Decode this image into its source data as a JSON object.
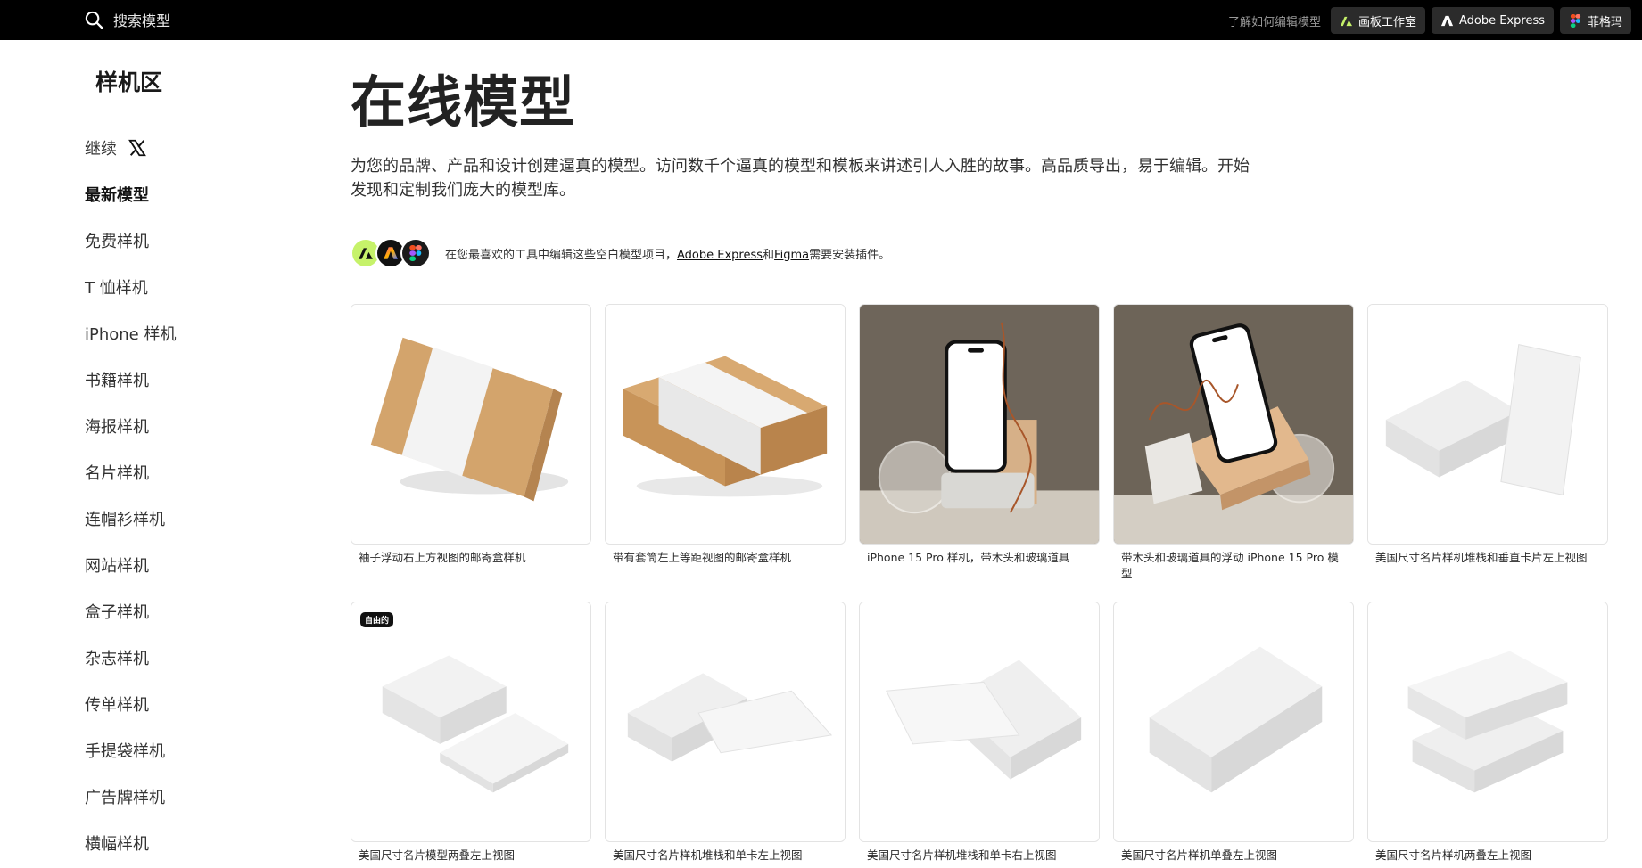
{
  "topbar": {
    "search_placeholder": "搜索模型",
    "learn_link": "了解如何编辑模型",
    "buttons": [
      {
        "label": "画板工作室",
        "icon": "artboard-studio-icon"
      },
      {
        "label": "Adobe Express",
        "icon": "adobe-express-icon"
      },
      {
        "label": "菲格玛",
        "icon": "figma-icon"
      }
    ]
  },
  "sidebar": {
    "title": "样机区",
    "items": [
      {
        "label": "继续"
      },
      {
        "label": "最新模型"
      },
      {
        "label": "免费样机"
      },
      {
        "label": "T 恤样机"
      },
      {
        "label": "iPhone 样机"
      },
      {
        "label": "书籍样机"
      },
      {
        "label": "海报样机"
      },
      {
        "label": "名片样机"
      },
      {
        "label": "连帽衫样机"
      },
      {
        "label": "网站样机"
      },
      {
        "label": "盒子样机"
      },
      {
        "label": "杂志样机"
      },
      {
        "label": "传单样机"
      },
      {
        "label": "手提袋样机"
      },
      {
        "label": "广告牌样机"
      },
      {
        "label": "横幅样机"
      }
    ]
  },
  "main": {
    "title_light": "在线",
    "title_bold": "模型",
    "description": "为您的品牌、产品和设计创建逼真的模型。访问数千个逼真的模型和模板来讲述引人入胜的故事。高品质导出，易于编辑。开始发现和定制我们庞大的模型库。",
    "tools_text_prefix": "在您最喜欢的工具中编辑这些空白模型项目，",
    "tools_link_1": "Adobe Express",
    "tools_text_and": "和",
    "tools_link_2": "Figma",
    "tools_text_suffix": "需要安装插件。",
    "badge_free": "自由的",
    "cards": [
      {
        "caption": "袖子浮动右上方视图的邮寄盒样机",
        "image": "mailer-box-sleeve-tilted"
      },
      {
        "caption": "带有套筒左上等距视图的邮寄盒样机",
        "image": "mailer-box-sleeve-isometric"
      },
      {
        "caption": "iPhone 15 Pro 样机，带木头和玻璃道具",
        "image": "iphone-wood-glass"
      },
      {
        "caption": "带木头和玻璃道具的浮动 iPhone 15 Pro 模型",
        "image": "iphone-floating-wood"
      },
      {
        "caption": "美国尺寸名片样机堆栈和垂直卡片左上视图",
        "image": "business-card-stack-vertical"
      },
      {
        "caption": "美国尺寸名片模型两叠左上视图",
        "image": "business-card-two-stacks",
        "free": true
      },
      {
        "caption": "美国尺寸名片样机堆栈和单卡左上视图",
        "image": "business-card-stack-single-left"
      },
      {
        "caption": "美国尺寸名片样机堆栈和单卡右上视图",
        "image": "business-card-stack-single-right"
      },
      {
        "caption": "美国尺寸名片样机单叠左上视图",
        "image": "business-card-single-stack"
      },
      {
        "caption": "美国尺寸名片样机两叠左上视图",
        "image": "business-card-two-stacks-stacked"
      }
    ]
  }
}
